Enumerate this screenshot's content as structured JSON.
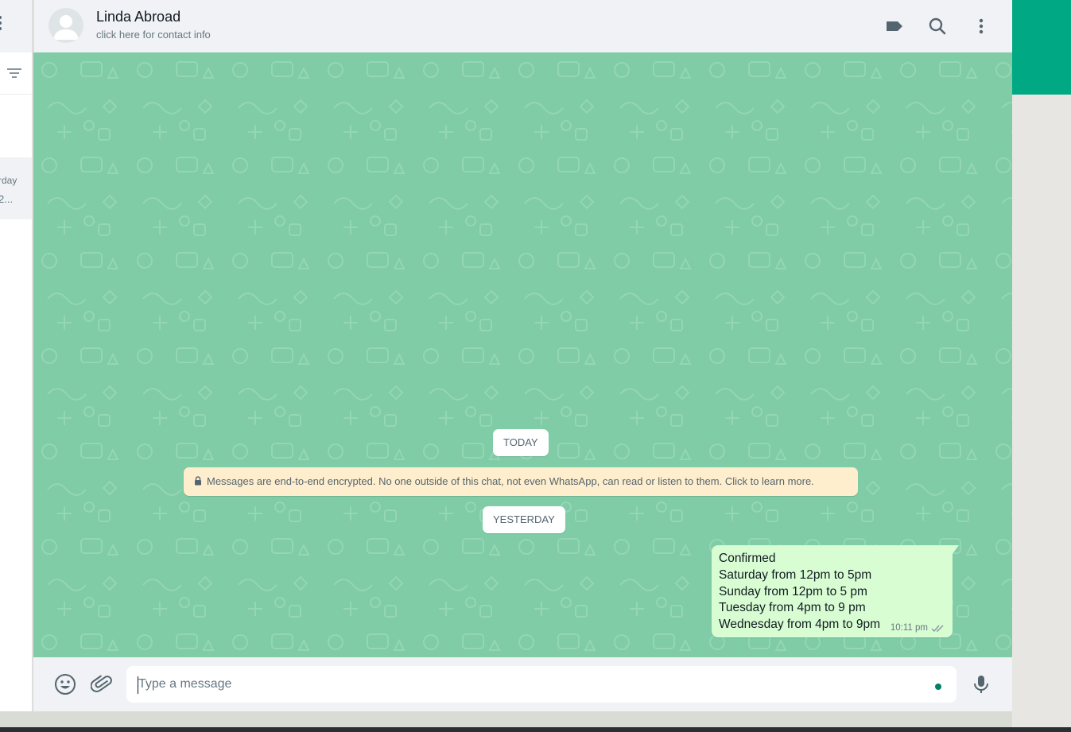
{
  "colors": {
    "accent": "#00a884",
    "chat_bg": "#7fcca6",
    "outgoing_bubble": "#d9fdd3",
    "notice_bg": "#ffeecd",
    "header_bg": "#f0f2f5",
    "icon_gray": "#54656f"
  },
  "sidebar": {
    "chat_item": {
      "time_fragment": "rday",
      "preview_fragment": "2..."
    }
  },
  "header": {
    "contact_name": "Linda Abroad",
    "contact_subtitle": "click here for contact info",
    "icons": [
      "label-icon",
      "search-icon",
      "more-options-icon"
    ]
  },
  "chat": {
    "date_today": "TODAY",
    "encryption_notice": "Messages are end-to-end encrypted. No one outside of this chat, not even WhatsApp, can read or listen to them. Click to learn more.",
    "date_yesterday": "YESTERDAY",
    "messages": [
      {
        "direction": "outgoing",
        "lines": [
          "Confirmed",
          "Saturday from 12pm to 5pm",
          "Sunday from 12pm to 5 pm",
          "Tuesday from 4pm to 9 pm",
          "Wednesday from 4pm to 9pm"
        ],
        "time": "10:11 pm",
        "status": "read"
      }
    ]
  },
  "composer": {
    "placeholder": "Type a message",
    "value": "",
    "icons": [
      "emoji-icon",
      "attach-icon",
      "mic-icon"
    ]
  }
}
